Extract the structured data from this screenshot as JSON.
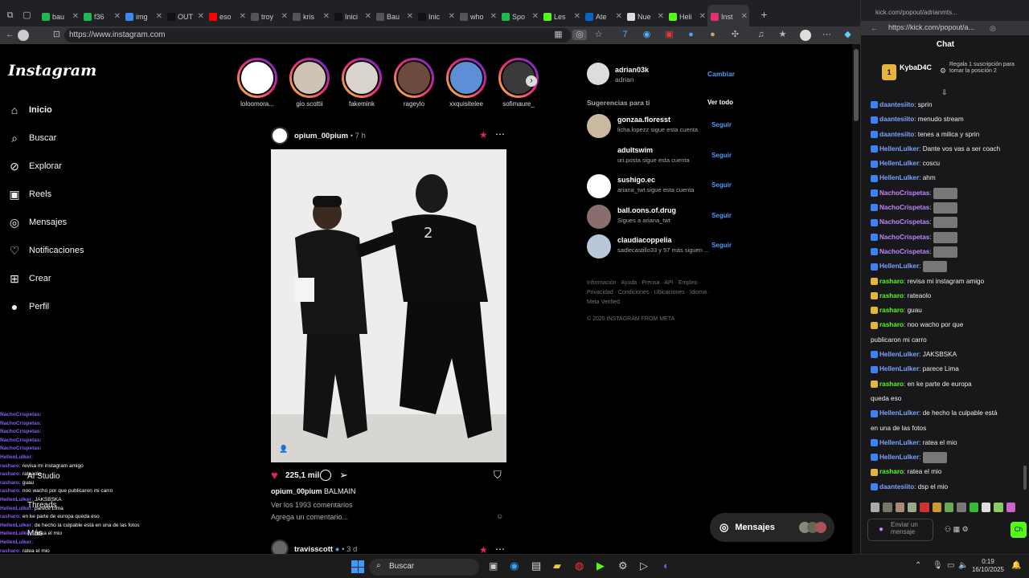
{
  "browser": {
    "tabs": [
      {
        "label": "bau",
        "color": "#1db954"
      },
      {
        "label": "f36",
        "color": "#1db954"
      },
      {
        "label": "img",
        "color": "#4285f4"
      },
      {
        "label": "OUT",
        "color": "#111111"
      },
      {
        "label": "eso",
        "color": "#ff0000"
      },
      {
        "label": "troy",
        "color": "#555555"
      },
      {
        "label": "kris",
        "color": "#555555"
      },
      {
        "label": "Inici",
        "color": "#111111"
      },
      {
        "label": "Bau",
        "color": "#555555"
      },
      {
        "label": "Inic",
        "color": "#111111"
      },
      {
        "label": "who",
        "color": "#555555"
      },
      {
        "label": "Spo",
        "color": "#1db954"
      },
      {
        "label": "Les",
        "color": "#53fc18"
      },
      {
        "label": "Ate",
        "color": "#0a66c2"
      },
      {
        "label": "Nue",
        "color": "#dddddd"
      },
      {
        "label": "Heli",
        "color": "#53fc18"
      },
      {
        "label": "Inst",
        "color": "#e1306c"
      }
    ],
    "url": "https://www.instagram.com"
  },
  "instagram": {
    "logo": "Instagram",
    "nav": [
      {
        "label": "Inicio",
        "icon": "home-icon"
      },
      {
        "label": "Buscar",
        "icon": "search-icon"
      },
      {
        "label": "Explorar",
        "icon": "compass-icon"
      },
      {
        "label": "Reels",
        "icon": "reels-icon"
      },
      {
        "label": "Mensajes",
        "icon": "messenger-icon"
      },
      {
        "label": "Notificaciones",
        "icon": "heart-icon"
      },
      {
        "label": "Crear",
        "icon": "plus-icon"
      },
      {
        "label": "Perfil",
        "icon": "avatar-icon"
      }
    ],
    "overlay_nav": [
      "AI Studio",
      "Threads",
      "Más"
    ],
    "stories": [
      "loloomora...",
      "gio.scottii",
      "fakemink",
      "rageylo",
      "xxquisitelee",
      "sofimaure_"
    ],
    "post": {
      "user": "opium_00pium",
      "time": "7 h",
      "likes": "225,1 mil",
      "caption_user": "opium_00pium",
      "caption": "BALMAIN",
      "comments": "Ver los 1993 comentarios",
      "add_comment": "Agrega un comentario..."
    },
    "next_post": {
      "user": "travisscott",
      "time": "3 d"
    },
    "account": {
      "username": "adrian03k",
      "name": "adrian",
      "switch": "Cambiar"
    },
    "suggestions_title": "Sugerencias para ti",
    "see_all": "Ver todo",
    "suggestions": [
      {
        "name": "gonzaa.floresst",
        "sub": "licha.lopezz sigue esta cuenta",
        "follow": "Seguir",
        "color": "#c9b9a0"
      },
      {
        "name": "adultswim",
        "sub": "uri.posta sigue esta cuenta",
        "follow": "Seguir",
        "color": "#000000"
      },
      {
        "name": "sushigo.ec",
        "sub": "ariana_twt sigue esta cuenta",
        "follow": "Seguir",
        "color": "#ffffff"
      },
      {
        "name": "ball.oons.of.drug",
        "sub": "Sigues a ariana_twt",
        "follow": "Seguir",
        "color": "#8a6e6e"
      },
      {
        "name": "claudiacoppelia",
        "sub": "sadlecastillo33 y 57 más siguen ...",
        "follow": "Seguir",
        "color": "#b9c8d9"
      }
    ],
    "footer_line1": "Información · Ayuda · Prensa · API · Empleo ·",
    "footer_line2": "Privacidad · Condiciones · Ubicaciones · Idioma ·",
    "footer_line3": "Meta Verified",
    "copyright": "© 2025 INSTAGRAM FROM META",
    "messages_button": "Mensajes"
  },
  "overlay_chat": [
    {
      "user": "NachoCrispetas:",
      "text": ""
    },
    {
      "user": "NachoCrispetas:",
      "text": ""
    },
    {
      "user": "NachoCrispetas:",
      "text": ""
    },
    {
      "user": "NachoCrispetas:",
      "text": ""
    },
    {
      "user": "NachoCrispetas:",
      "text": ""
    },
    {
      "user": "HellenLulker:",
      "text": ""
    },
    {
      "user": "rasharo:",
      "text": "revisa mi instagram amigo"
    },
    {
      "user": "rasharo:",
      "text": "rateaolo"
    },
    {
      "user": "rasharo:",
      "text": "guau"
    },
    {
      "user": "rasharo:",
      "text": "noo wacho por que publicaron mi carro"
    },
    {
      "user": "HellenLulker:",
      "text": "JAKSBSKA"
    },
    {
      "user": "HellenLulker:",
      "text": "parece Lima"
    },
    {
      "user": "rasharo:",
      "text": "en ke parte de europa queda eso"
    },
    {
      "user": "HellenLulker:",
      "text": "de hecho la culpable está en una de las fotos"
    },
    {
      "user": "HellenLulker:",
      "text": "ratea el mio"
    },
    {
      "user": "HellenLulker:",
      "text": ""
    },
    {
      "user": "rasharo:",
      "text": "ratea el mio"
    },
    {
      "user": "daantesiito:",
      "text": "dsp el mio"
    }
  ],
  "kick": {
    "window_title": "kick.com/popout/adrianmts...",
    "url": "https://kick.com/popout/a...",
    "chat_label": "Chat",
    "gift_user": "KybaD4C",
    "gift_count": "1",
    "gift_text": "Regala 1 suscripción para tomar la posición 2",
    "messages": [
      {
        "user": "daantesiito",
        "color": "#7da3ff",
        "text": "sprin"
      },
      {
        "user": "daantesiito",
        "color": "#7da3ff",
        "text": "menudo stream"
      },
      {
        "user": "daantesiito",
        "color": "#7da3ff",
        "text": "tenes a milica y sprin"
      },
      {
        "user": "HellenLulker",
        "color": "#7da3ff",
        "text": "Dante vos vas a ser coach"
      },
      {
        "user": "",
        "color": "#7da3ff",
        "text": ""
      },
      {
        "user": "HellenLulker",
        "color": "#7da3ff",
        "text": "coscu"
      },
      {
        "user": "HellenLulker",
        "color": "#7da3ff",
        "text": "ahm"
      },
      {
        "user": "NachoCrispetas",
        "color": "#c084fc",
        "text": ""
      },
      {
        "user": "NachoCrispetas",
        "color": "#c084fc",
        "text": ""
      },
      {
        "user": "NachoCrispetas",
        "color": "#c084fc",
        "text": ""
      },
      {
        "user": "NachoCrispetas",
        "color": "#c084fc",
        "text": ""
      },
      {
        "user": "NachoCrispetas",
        "color": "#c084fc",
        "text": ""
      },
      {
        "user": "HellenLulker",
        "color": "#7da3ff",
        "text": ""
      },
      {
        "user": "rasharo",
        "color": "#53fc18",
        "text": "revisa mi instagram amigo"
      },
      {
        "user": "rasharo",
        "color": "#53fc18",
        "text": "rateaolo"
      },
      {
        "user": "rasharo",
        "color": "#53fc18",
        "text": "guau"
      },
      {
        "user": "rasharo",
        "color": "#53fc18",
        "text": "noo wacho por que"
      },
      {
        "user": "",
        "color": "#53fc18",
        "text": "publicaron mi carro"
      },
      {
        "user": "HellenLulker",
        "color": "#7da3ff",
        "text": "JAKSBSKA"
      },
      {
        "user": "HellenLulker",
        "color": "#7da3ff",
        "text": "parece Lima"
      },
      {
        "user": "rasharo",
        "color": "#53fc18",
        "text": "en ke parte de europa"
      },
      {
        "user": "",
        "color": "#53fc18",
        "text": "queda eso"
      },
      {
        "user": "HellenLulker",
        "color": "#7da3ff",
        "text": "de hecho la culpable está"
      },
      {
        "user": "",
        "color": "#7da3ff",
        "text": "en una de las fotos"
      },
      {
        "user": "HellenLulker",
        "color": "#7da3ff",
        "text": "ratea el mio"
      },
      {
        "user": "HellenLulker",
        "color": "#7da3ff",
        "text": ""
      },
      {
        "user": "rasharo",
        "color": "#53fc18",
        "text": "ratea el mio"
      },
      {
        "user": "daantesiito",
        "color": "#7da3ff",
        "text": "dsp el mio"
      }
    ],
    "input_placeholder": "Enviar un mensaje",
    "send": "Ch"
  },
  "taskbar": {
    "search_placeholder": "Buscar",
    "time": "0:19",
    "date": "16/10/2025"
  }
}
